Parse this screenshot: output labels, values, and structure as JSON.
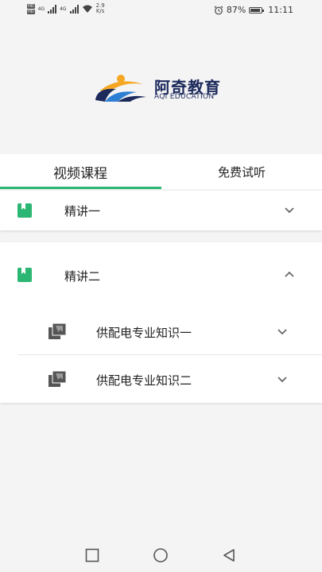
{
  "status": {
    "net_badges": [
      "HD",
      "HD"
    ],
    "net_labels": [
      "4G",
      "4G"
    ],
    "speed_value": "2.9",
    "speed_unit": "K/s",
    "battery": "87%",
    "battery_level": 0.87,
    "time": "11:11"
  },
  "brand": {
    "name_cn": "阿奇教育",
    "name_en": "AQI EDUCATION",
    "colors": {
      "navy": "#1c2a5c",
      "orange": "#f5a623",
      "blue": "#2d7fd3"
    }
  },
  "tabs": [
    {
      "label": "视频课程",
      "active": true
    },
    {
      "label": "免费试听",
      "active": false
    }
  ],
  "sections": [
    {
      "title": "精讲一",
      "expanded": false,
      "icon": "book-icon"
    },
    {
      "title": "精讲二",
      "expanded": true,
      "icon": "book-icon",
      "items": [
        {
          "title": "供配电专业知识一",
          "icon": "library-icon"
        },
        {
          "title": "供配电专业知识二",
          "icon": "library-icon"
        }
      ]
    }
  ],
  "accent_color": "#2bb673",
  "nav": [
    "square-icon",
    "circle-icon",
    "back-triangle-icon"
  ]
}
